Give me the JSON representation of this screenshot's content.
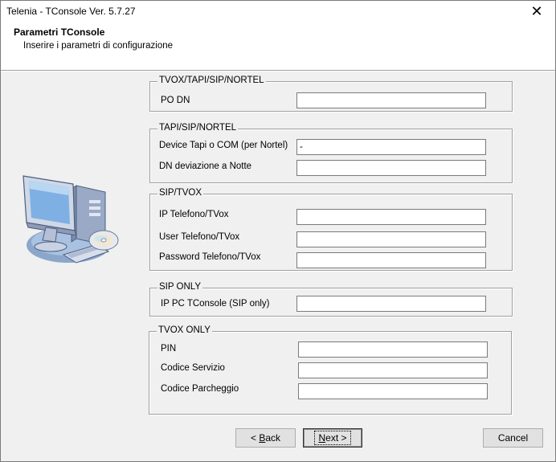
{
  "window": {
    "title": "Telenia - TConsole Ver. 5.7.27",
    "close_glyph": "✕"
  },
  "header": {
    "title": "Parametri TConsole",
    "subtitle": "Inserire i parametri di configurazione"
  },
  "groups": {
    "tvox_tapi_sip_nortel": {
      "legend": "TVOX/TAPI/SIP/NORTEL",
      "po_dn": {
        "label": "PO DN",
        "value": ""
      }
    },
    "tapi_sip_nortel": {
      "legend": "TAPI/SIP/NORTEL",
      "device_tapi": {
        "label": "Device Tapi o COM (per Nortel)",
        "value": "-"
      },
      "dn_deviazione": {
        "label": "DN deviazione a Notte",
        "value": ""
      }
    },
    "sip_tvox": {
      "legend": "SIP/TVOX",
      "ip_telefono": {
        "label": "IP Telefono/TVox",
        "value": ""
      },
      "user_telefono": {
        "label": "User Telefono/TVox",
        "value": ""
      },
      "password_telefono": {
        "label": "Password Telefono/TVox",
        "value": ""
      }
    },
    "sip_only": {
      "legend": "SIP ONLY",
      "ip_pc": {
        "label": "IP PC TConsole (SIP only)",
        "value": ""
      }
    },
    "tvox_only": {
      "legend": "TVOX ONLY",
      "pin": {
        "label": "PIN",
        "value": ""
      },
      "codice_servizio": {
        "label": "Codice Servizio",
        "value": ""
      },
      "codice_parcheggio": {
        "label": "Codice Parcheggio",
        "value": ""
      }
    }
  },
  "buttons": {
    "back": {
      "prefix": "< ",
      "mnemonic": "B",
      "rest": "ack"
    },
    "next": {
      "mnemonic": "N",
      "rest": "ext >"
    },
    "cancel": "Cancel"
  }
}
